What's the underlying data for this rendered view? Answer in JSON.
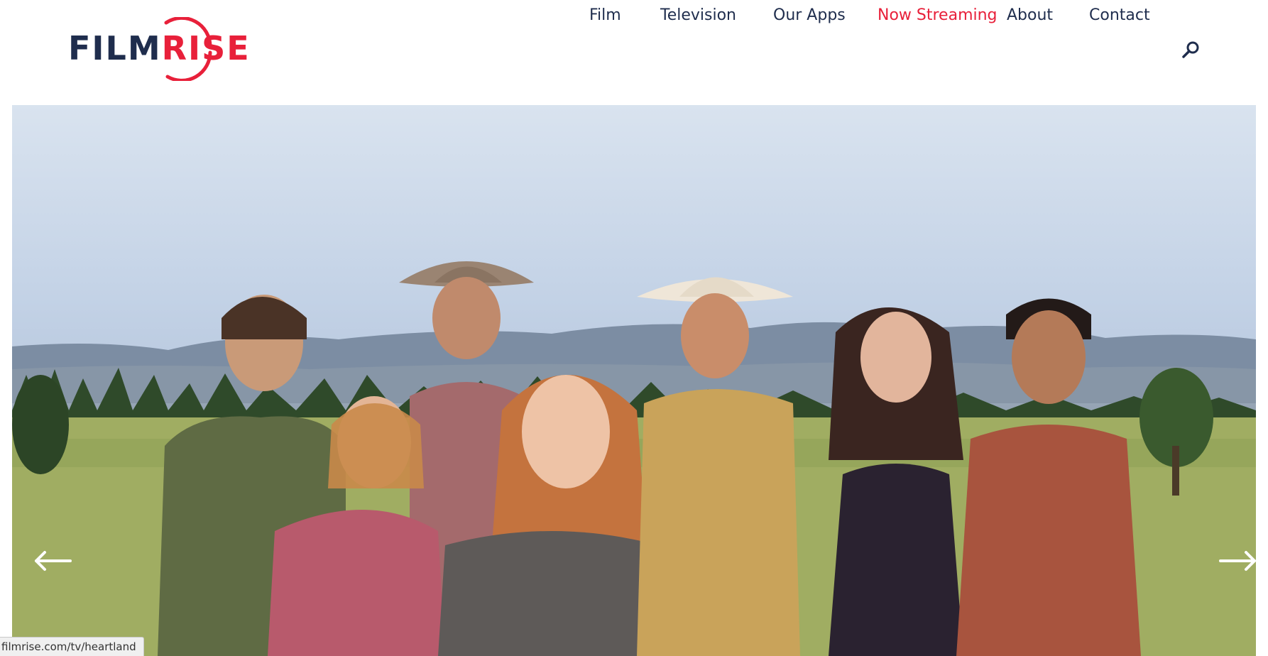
{
  "brand": {
    "logo_part_1": "FILM",
    "logo_part_2": "RISE",
    "primary_color": "#1f2d4d",
    "accent_color": "#e8203a"
  },
  "nav": {
    "items": [
      {
        "label": "Film",
        "active": false
      },
      {
        "label": "Television",
        "active": false
      },
      {
        "label": "Our Apps",
        "active": false
      },
      {
        "label": "Now Streaming",
        "active": true
      },
      {
        "label": "About",
        "active": false
      },
      {
        "label": "Contact",
        "active": false
      }
    ],
    "search_icon": "search-icon"
  },
  "hero": {
    "prev_icon": "arrow-left-icon",
    "next_icon": "arrow-right-icon"
  },
  "status_bar": {
    "url": "filmrise.com/tv/heartland"
  }
}
